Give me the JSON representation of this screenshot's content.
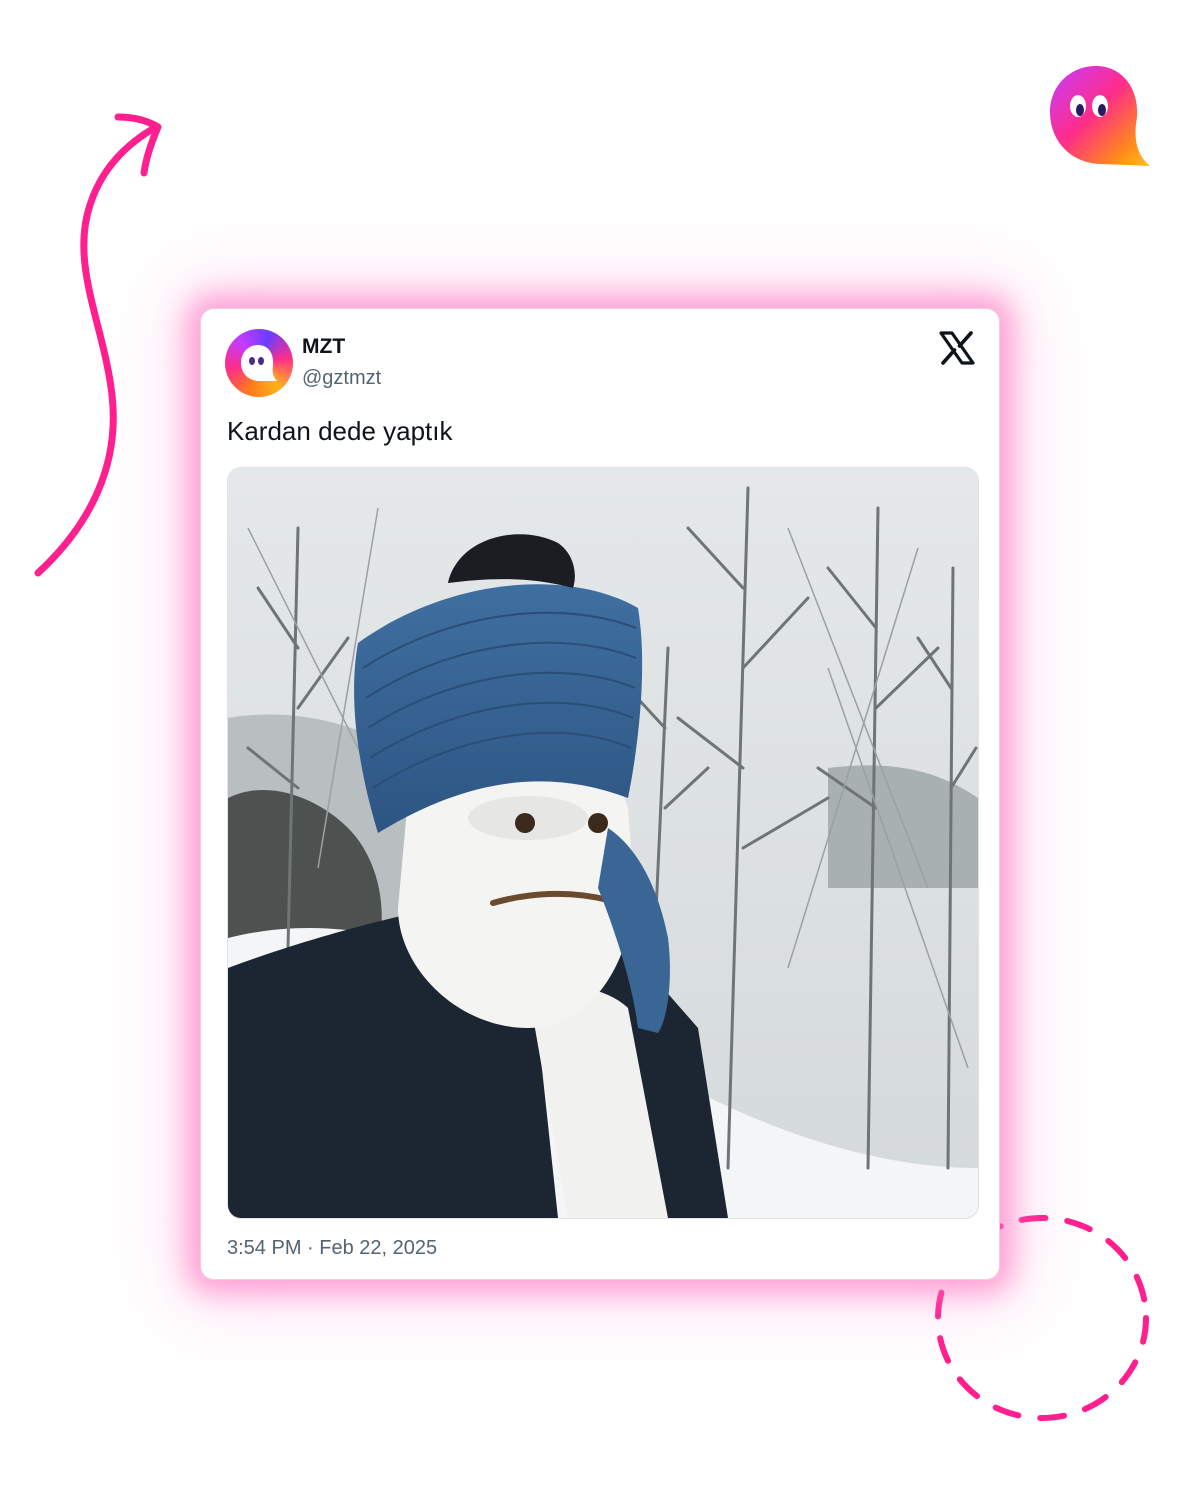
{
  "tweet": {
    "display_name": "MZT",
    "handle": "@gztmzt",
    "text": "Kardan dede yaptık",
    "timestamp": "3:54 PM · Feb 22, 2025",
    "platform_icon": "x-logo-icon",
    "media_description_icon": "snowman-photo"
  },
  "decorations": {
    "accent_color": "#ff1f8e",
    "brand_icon": "ghost-logo-icon",
    "arrow_icon": "curved-arrow-icon",
    "circle_icon": "dashed-circle-icon"
  },
  "colors": {
    "background": "#ffffff",
    "card_glow": "#ff69be",
    "text_primary": "#0f1419",
    "text_secondary": "#536471"
  }
}
